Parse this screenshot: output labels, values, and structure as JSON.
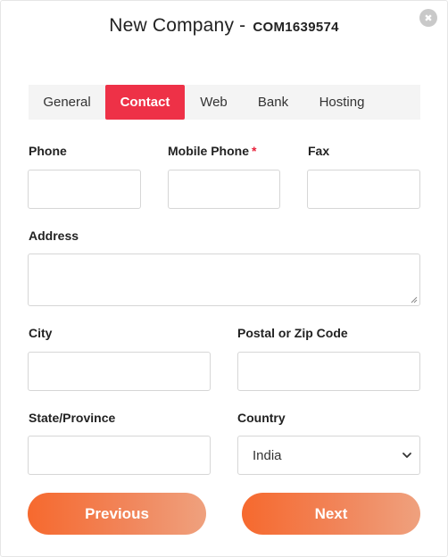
{
  "modal": {
    "title": "New Company -",
    "code": "COM1639574",
    "close_glyph": "✖"
  },
  "tabs": [
    {
      "label": "General",
      "active": false
    },
    {
      "label": "Contact",
      "active": true
    },
    {
      "label": "Web",
      "active": false
    },
    {
      "label": "Bank",
      "active": false
    },
    {
      "label": "Hosting",
      "active": false
    }
  ],
  "form": {
    "phone": {
      "label": "Phone",
      "value": ""
    },
    "mobile": {
      "label": "Mobile Phone",
      "required_mark": "*",
      "value": ""
    },
    "fax": {
      "label": "Fax",
      "value": ""
    },
    "address": {
      "label": "Address",
      "value": ""
    },
    "city": {
      "label": "City",
      "value": ""
    },
    "postal": {
      "label": "Postal or Zip Code",
      "value": ""
    },
    "state": {
      "label": "State/Province",
      "value": ""
    },
    "country": {
      "label": "Country",
      "selected": "India"
    }
  },
  "buttons": {
    "previous": "Previous",
    "next": "Next"
  },
  "colors": {
    "accent_tab": "#ee3147",
    "button_start": "#f6692e",
    "button_end": "#efa17e",
    "required": "#e8203a"
  },
  "icons": {
    "close": "close-icon",
    "select_arrow": "chevron-down-icon",
    "resize": "resize-grip-icon"
  }
}
